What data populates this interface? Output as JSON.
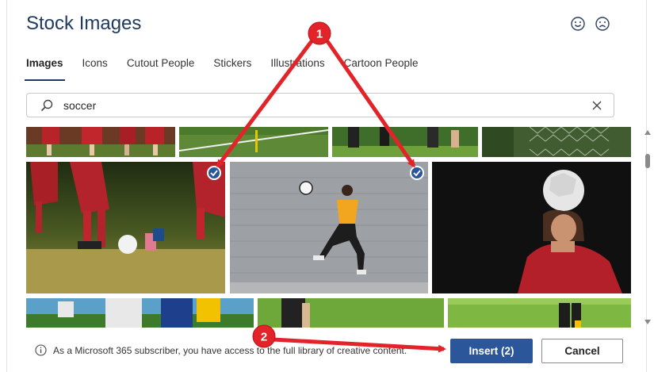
{
  "dialog": {
    "title": "Stock Images",
    "feedback_icons": [
      "smile-icon",
      "frown-icon"
    ]
  },
  "tabs": [
    {
      "label": "Images",
      "active": true
    },
    {
      "label": "Icons",
      "active": false
    },
    {
      "label": "Cutout People",
      "active": false
    },
    {
      "label": "Stickers",
      "active": false
    },
    {
      "label": "Illustrations",
      "active": false
    },
    {
      "label": "Cartoon People",
      "active": false
    }
  ],
  "search": {
    "value": "soccer",
    "icon": "search-icon",
    "clear_icon": "close-icon"
  },
  "images": [
    {
      "name": "soccer-legs-top-1",
      "selected": false
    },
    {
      "name": "soccer-field-line",
      "selected": false
    },
    {
      "name": "soccer-players-running",
      "selected": false
    },
    {
      "name": "soccer-goal-net",
      "selected": false
    },
    {
      "name": "youth-players-kicking-ball",
      "selected": true
    },
    {
      "name": "player-jumping-gray-wall",
      "selected": true
    },
    {
      "name": "girl-heading-ball",
      "selected": false
    },
    {
      "name": "players-in-white-yellow",
      "selected": false
    },
    {
      "name": "player-on-grass",
      "selected": false
    },
    {
      "name": "green-field",
      "selected": false
    },
    {
      "name": "player-legs-field",
      "selected": false
    }
  ],
  "footer": {
    "info_text": "As a Microsoft 365 subscriber, you have access to the full library of creative content.",
    "insert_label": "Insert (2)",
    "cancel_label": "Cancel"
  },
  "annotations": {
    "callout_1": "1",
    "callout_2": "2",
    "color": "#e2242a"
  },
  "colors": {
    "accent": "#2b579a",
    "title": "#1f3a60"
  }
}
